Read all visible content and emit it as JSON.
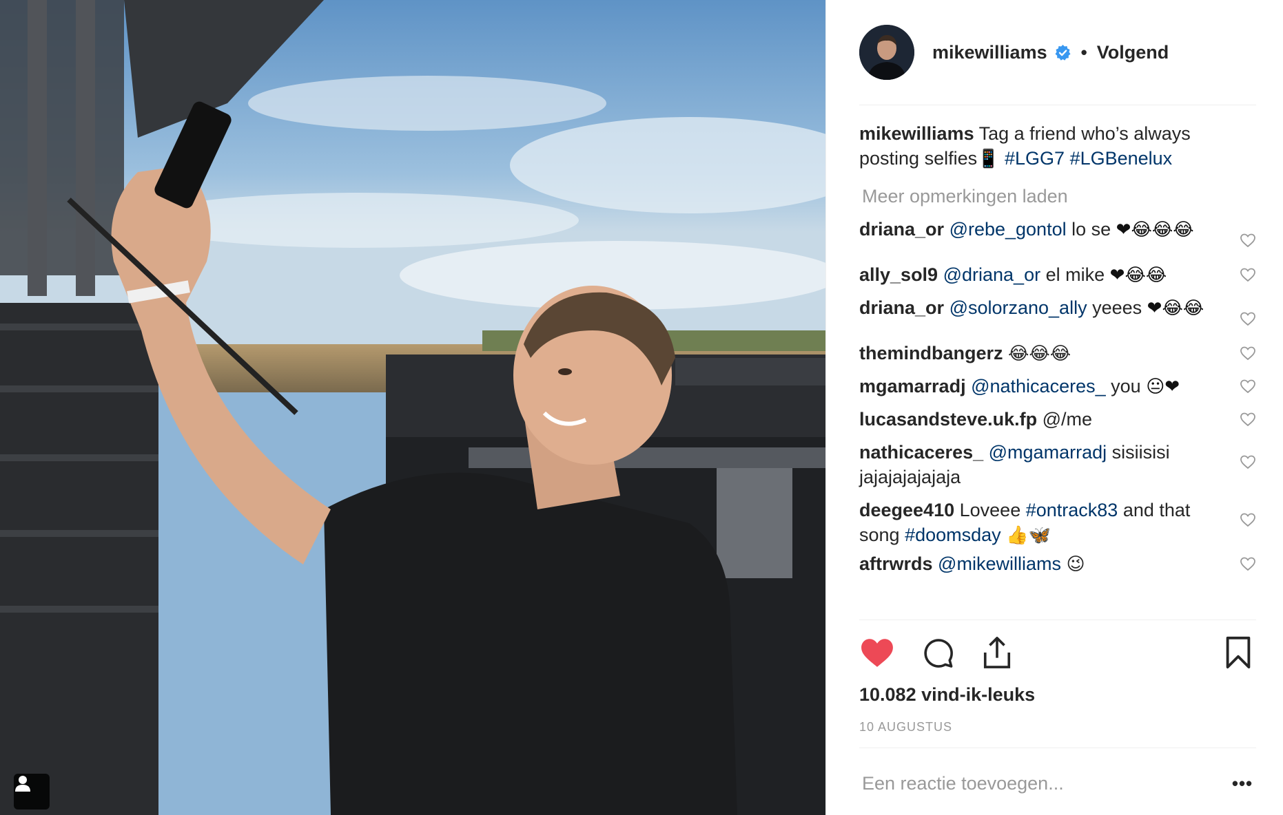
{
  "post": {
    "author": "mikewilliams",
    "separator": "•",
    "follow_label": "Volgend",
    "caption_user": "mikewilliams",
    "caption_text": "Tag a friend who’s always posting selfies",
    "caption_emoji": "📱",
    "caption_tags": [
      "#LGG7",
      "#LGBenelux"
    ],
    "load_more": "Meer opmerkingen laden",
    "likes": "10.082 vind-ik-leuks",
    "date": "10 AUGUSTUS",
    "add_comment_placeholder": "Een reactie toevoegen...",
    "options_label": "•••"
  },
  "comments": [
    {
      "user": "driana_or",
      "mention": "@rebe_gontol",
      "text": "lo se",
      "emoji": "❤😂😂😂"
    },
    {
      "user": "ally_sol9",
      "mention": "@driana_or",
      "text": "el mike",
      "emoji": "❤😂😂"
    },
    {
      "user": "driana_or",
      "mention": "@solorzano_ally",
      "text": "yeees",
      "emoji": "❤😂😂"
    },
    {
      "user": "themindbangerz",
      "mention": "",
      "text": "",
      "emoji": "😂😂😂"
    },
    {
      "user": "mgamarradj",
      "mention": "@nathicaceres_",
      "text": "you",
      "emoji": "😐❤"
    },
    {
      "user": "lucasandsteve.uk.fp",
      "mention": "",
      "text": "@/me",
      "emoji": ""
    },
    {
      "user": "nathicaceres_",
      "mention": "@mgamarradj",
      "text": "sisiisisi jajajajajajaja",
      "emoji": ""
    },
    {
      "user": "deegee410",
      "text_pre": "Loveee",
      "tag1": "#ontrack83",
      "text_mid": "and that song",
      "tag2": "#doomsday",
      "emoji": "👍🦋"
    },
    {
      "user": "aftrwrds",
      "mention": "@mikewilliams",
      "text": "",
      "emoji": "😉"
    }
  ],
  "icons": {
    "like": "heart-filled-icon",
    "comment": "comment-bubble-icon",
    "share": "share-upload-icon",
    "save": "bookmark-icon",
    "verified": "verified-badge-icon",
    "tag": "person-tag-icon"
  },
  "colors": {
    "like_red": "#ed4956",
    "verified_blue": "#3897f0",
    "link_blue": "#003569",
    "muted": "#999999",
    "text": "#262626"
  }
}
